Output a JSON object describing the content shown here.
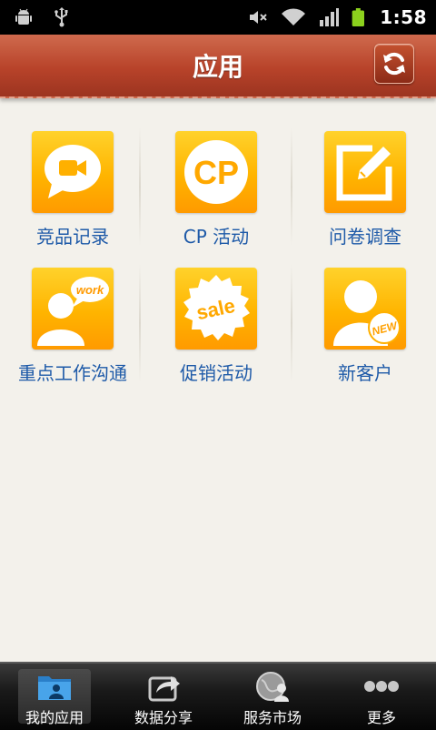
{
  "status_bar": {
    "time": "1:58",
    "icons": [
      "android-icon",
      "usb-icon",
      "mute-icon",
      "wifi-icon",
      "signal-icon",
      "battery-icon"
    ]
  },
  "header": {
    "title": "应用",
    "refresh_icon": "refresh-icon",
    "background": "#b8432a"
  },
  "apps": [
    {
      "label": "竞品记录",
      "icon": "video-chat-bubble-icon"
    },
    {
      "label": "CP 活动",
      "icon": "cp-icon",
      "icon_text": "CP"
    },
    {
      "label": "问卷调查",
      "icon": "edit-form-icon"
    },
    {
      "label": "重点工作沟通",
      "icon": "person-work-bubble-icon",
      "icon_text": "work"
    },
    {
      "label": "促销活动",
      "icon": "sale-seal-icon",
      "icon_text": "sale"
    },
    {
      "label": "新客户",
      "icon": "person-new-badge-icon",
      "icon_text": "NEW"
    }
  ],
  "bottom_nav": [
    {
      "label": "我的应用",
      "icon": "folder-person-icon",
      "active": true
    },
    {
      "label": "数据分享",
      "icon": "share-icon",
      "active": false
    },
    {
      "label": "服务市场",
      "icon": "globe-person-icon",
      "active": false
    },
    {
      "label": "更多",
      "icon": "more-dots-icon",
      "active": false
    }
  ],
  "colors": {
    "tile_orange": "#ffb400",
    "label_blue": "#1e5aa8",
    "page_bg": "#f3f1eb"
  }
}
